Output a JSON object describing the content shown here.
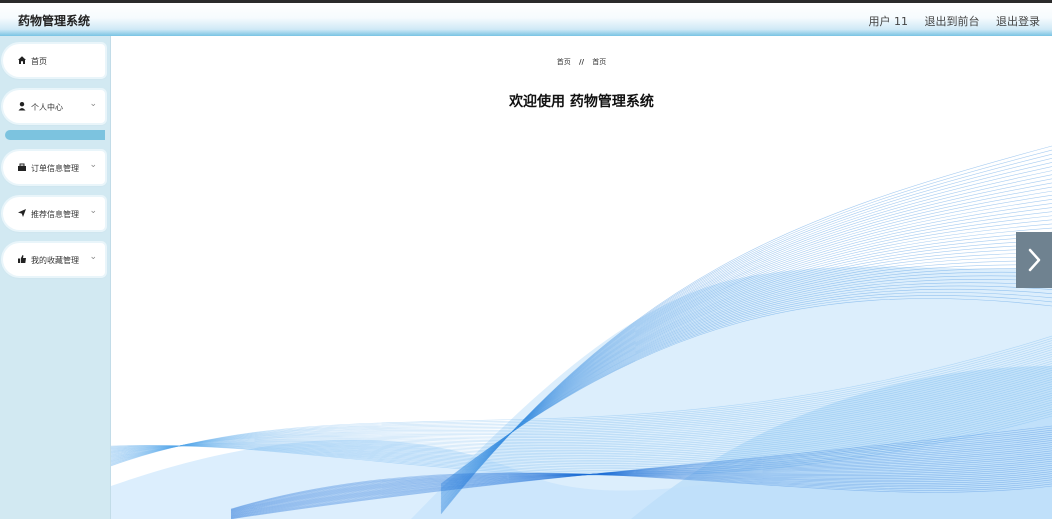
{
  "app": {
    "title": "药物管理系统"
  },
  "header": {
    "user_label": "用户 11",
    "back_to_front": "退出到前台",
    "logout": "退出登录"
  },
  "sidebar": {
    "items": [
      {
        "label": "首页",
        "icon": "home-icon"
      },
      {
        "label": "个人中心",
        "icon": "user-icon",
        "has_submenu": true
      },
      {
        "label": "订单信息管理",
        "icon": "order-icon",
        "has_submenu": true
      },
      {
        "label": "推荐信息管理",
        "icon": "send-icon",
        "has_submenu": true
      },
      {
        "label": "我的收藏管理",
        "icon": "favorite-icon",
        "has_submenu": true
      }
    ],
    "chevron": "⌄"
  },
  "main": {
    "breadcrumb": {
      "first": "首页",
      "separator": "//",
      "second": "首页"
    },
    "welcome": "欢迎使用 药物管理系统"
  },
  "colors": {
    "accent": "#79c3e3",
    "sidebar_bg": "#d2e9f2",
    "wave": "#3b8fe0"
  }
}
